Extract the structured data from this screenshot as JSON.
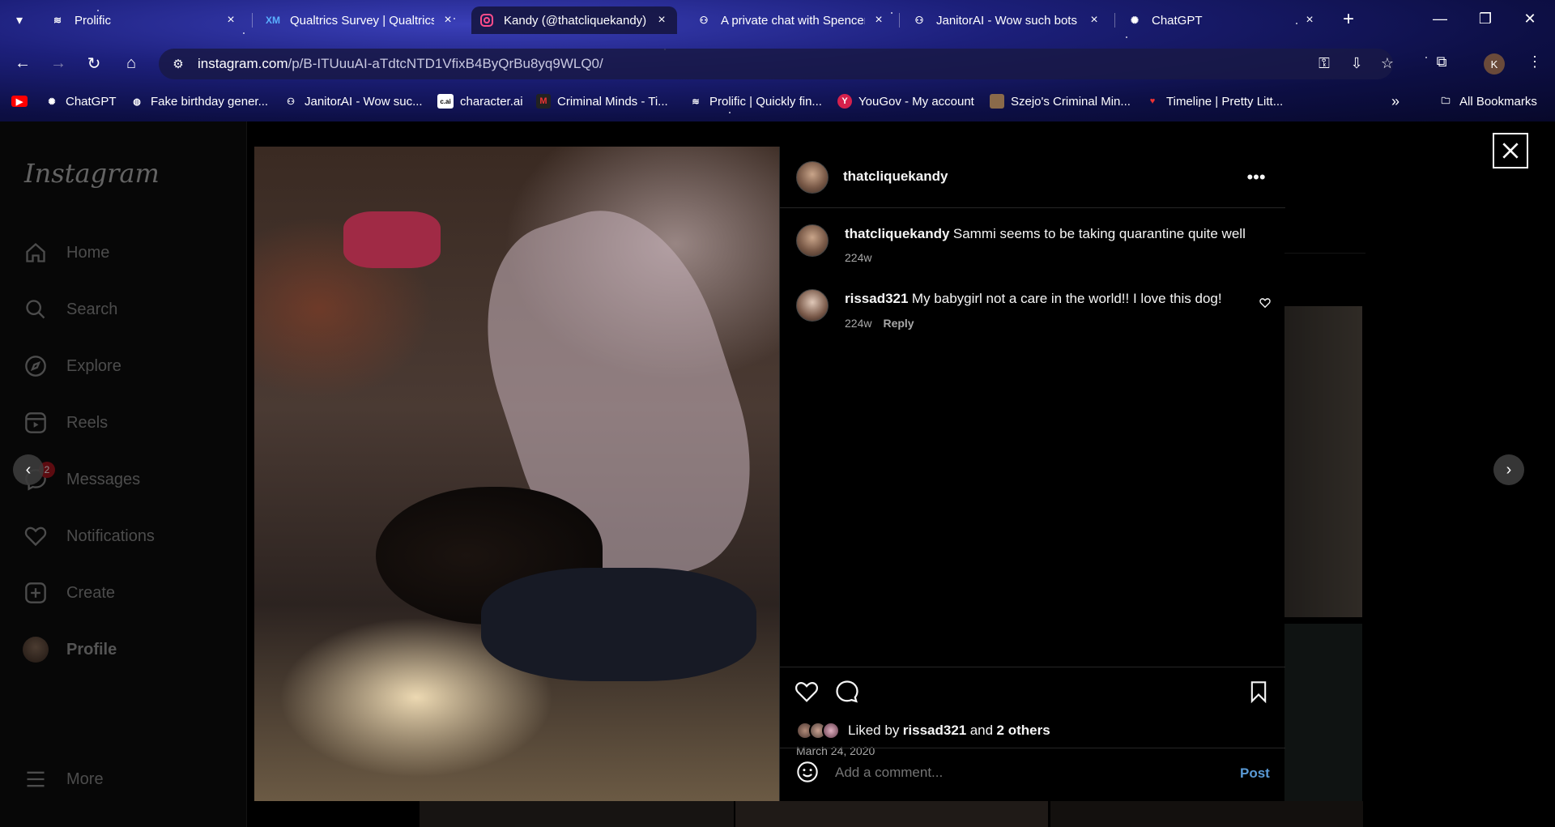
{
  "browser": {
    "tabs": [
      {
        "title": "Prolific",
        "favicon": "prolific-icon"
      },
      {
        "title": "Qualtrics Survey | Qualtrics",
        "favicon": "XM"
      },
      {
        "title": "Kandy (@thatcliquekandy)",
        "favicon": "instagram-icon",
        "active": true
      },
      {
        "title": "A private chat with Spencer",
        "favicon": "janitor-icon"
      },
      {
        "title": "JanitorAI - Wow such bots",
        "favicon": "janitor-icon"
      },
      {
        "title": "ChatGPT",
        "favicon": "chatgpt-icon"
      }
    ],
    "url_host": "instagram.com",
    "url_path": "/p/B-ITUuuAI-aTdtcNTD1VfixB4ByQrBu8yq9WLQ0/",
    "profile_initial": "K",
    "bookmarks": [
      {
        "label": "",
        "icon": "youtube-icon"
      },
      {
        "label": "ChatGPT",
        "icon": "chatgpt-icon"
      },
      {
        "label": "Fake birthday gener...",
        "icon": "globe-icon"
      },
      {
        "label": "JanitorAI - Wow suc...",
        "icon": "janitor-icon"
      },
      {
        "label": "character.ai",
        "icon": "c.ai"
      },
      {
        "label": "Criminal Minds - Ti...",
        "icon": "M"
      },
      {
        "label": "Prolific | Quickly fin...",
        "icon": "prolific-icon"
      },
      {
        "label": "YouGov - My account",
        "icon": "Y"
      },
      {
        "label": "Szejo's Criminal Min...",
        "icon": "image-icon"
      },
      {
        "label": "Timeline | Pretty Litt...",
        "icon": "heart-icon"
      }
    ],
    "all_bookmarks_label": "All Bookmarks"
  },
  "sidebar": {
    "logo": "Instagram",
    "items": [
      {
        "label": "Home",
        "icon": "home-icon"
      },
      {
        "label": "Search",
        "icon": "search-icon"
      },
      {
        "label": "Explore",
        "icon": "compass-icon"
      },
      {
        "label": "Reels",
        "icon": "reels-icon"
      },
      {
        "label": "Messages",
        "icon": "messenger-icon",
        "badge": "2"
      },
      {
        "label": "Notifications",
        "icon": "heart-icon"
      },
      {
        "label": "Create",
        "icon": "plus-square-icon"
      },
      {
        "label": "Profile",
        "icon": "avatar"
      }
    ],
    "more_label": "More"
  },
  "post": {
    "author": "thatcliquekandy",
    "caption": "Sammi seems to be taking quarantine quite well",
    "caption_age": "224w",
    "comments": [
      {
        "user": "rissad321",
        "text": "My babygirl not a care in the world!! I love this dog!",
        "age": "224w",
        "reply_label": "Reply"
      }
    ],
    "liked_by_prefix": "Liked by",
    "liked_by_user": "rissad321",
    "liked_by_and": "and",
    "liked_by_others": "2 others",
    "date": "March 24, 2020",
    "comment_placeholder": "Add a comment...",
    "post_button": "Post"
  },
  "colors": {
    "accent_link": "#0095f6",
    "badge": "#a8141e"
  }
}
